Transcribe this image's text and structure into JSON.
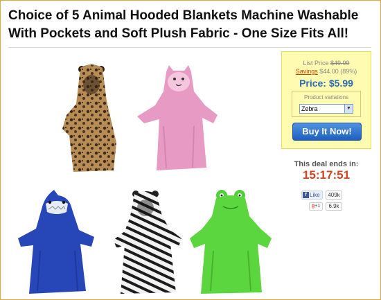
{
  "product": {
    "title": "Choice of 5 Animal Hooded Blankets Machine Washable With Pockets and Soft Plush Fabric - One Size Fits All!"
  },
  "images": [
    {
      "name": "leopard-blanket-image",
      "label": "Leopard"
    },
    {
      "name": "cat-blanket-image",
      "label": "Cat"
    },
    {
      "name": "shark-blanket-image",
      "label": "Shark"
    },
    {
      "name": "zebra-blanket-image",
      "label": "Zebra"
    },
    {
      "name": "frog-blanket-image",
      "label": "Frog"
    }
  ],
  "buybox": {
    "list_price_label": "List Price",
    "list_price_value": "$49.99",
    "savings_label": "Savings",
    "savings_value": "$44.00 (89%)",
    "price_label": "Price:",
    "price_value": "$5.99",
    "variations_label": "Product variations",
    "selected_variation": "Zebra",
    "buy_button_label": "Buy It Now!"
  },
  "deal": {
    "ends_label": "This deal ends in:",
    "countdown": "15:17:51"
  },
  "social": {
    "fb_like_label": "Like",
    "fb_like_count": "409k",
    "gplus_label": "+1",
    "gplus_count": "6.9k"
  },
  "colors": {
    "price_blue": "#2a6bb5",
    "countdown_red": "#cc4422",
    "buybox_bg": "#fffbb0",
    "button_blue": "#1e5fc0",
    "frame_orange": "#e6a832"
  }
}
